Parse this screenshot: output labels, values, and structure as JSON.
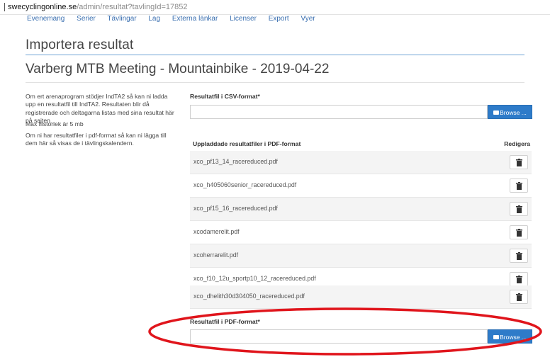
{
  "browser": {
    "url_host": "swecyclingonline.se",
    "url_path": "/admin/resultat?tavlingId=17852"
  },
  "nav": {
    "items": [
      "Evenemang",
      "Serier",
      "Tävlingar",
      "Lag",
      "Externa länkar",
      "Licenser",
      "Export",
      "Vyer"
    ]
  },
  "page": {
    "title": "Importera resultat",
    "subtitle": "Varberg MTB Meeting - Mountainbike - 2019-04-22"
  },
  "info": {
    "p1": "Om ert arenaprogram stödjer IndTA2 så kan ni ladda upp en resultatfil till IndTA2. Resultaten blir då registrerade och deltagarna listas med sina resultat här på sajten.",
    "p2": "Max filstorlek är 5 mb",
    "p3": "Om ni har resultatfiler i pdf-format så kan ni lägga till dem här så visas de i tävlingskalendern."
  },
  "csv": {
    "label": "Resultatfil i CSV-format*",
    "browse_label": "Browse ..."
  },
  "pdf_table": {
    "col_file": "Uppladdade resultatfiler i PDF-format",
    "col_edit": "Redigera",
    "files": [
      "xco_pf13_14_racereduced.pdf",
      "xco_h405060senior_racereduced.pdf",
      "xco_pf15_16_racereduced.pdf",
      "xcodamerelit.pdf",
      "xcoherrarelit.pdf",
      "xco_f10_12u_sportp10_12_racereduced.pdf",
      "xco_dhelith30d304050_racereduced.pdf"
    ]
  },
  "pdf_upload": {
    "label": "Resultatfil i PDF-format*",
    "browse_label": "Browse ..."
  },
  "colors": {
    "accent": "#2e7bc9",
    "annotation": "#e0151c"
  }
}
